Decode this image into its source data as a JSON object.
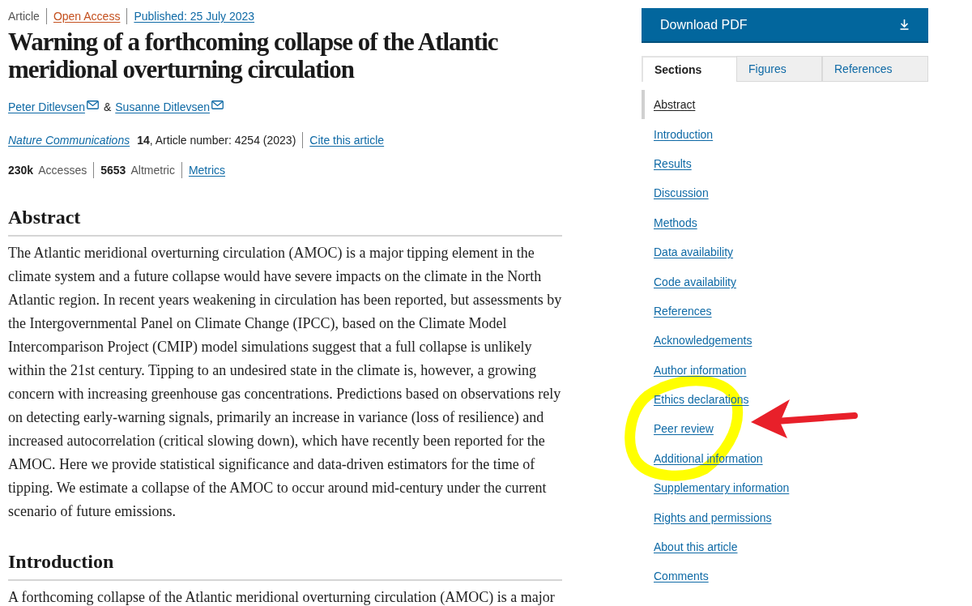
{
  "article_meta": {
    "type": "Article",
    "access": "Open Access",
    "published": "Published: 25 July 2023"
  },
  "title": "Warning of a forthcoming collapse of the Atlantic meridional overturning circulation",
  "authors": [
    {
      "name": "Peter Ditlevsen"
    },
    {
      "name": "Susanne Ditlevsen"
    }
  ],
  "author_separator": "&",
  "citation": {
    "journal": "Nature Communications",
    "details": "**14**, Article number: 4254 (2023)",
    "cite_link": "Cite this article"
  },
  "metrics": [
    {
      "text": "**230k** Accesses"
    },
    {
      "text": "**5653** Altmetric"
    }
  ],
  "metrics_link": "Metrics",
  "sections": [
    {
      "heading": "Abstract",
      "paragraph": "The Atlantic meridional overturning circulation (AMOC) is a major tipping element in the climate system and a future collapse would have severe impacts on the climate in the North Atlantic region. In recent years weakening in circulation has been reported, but assessments by the Intergovernmental Panel on Climate Change (IPCC), based on the Climate Model Intercomparison Project (CMIP) model simulations suggest that a full collapse is unlikely within the 21st century. Tipping to an undesired state in the climate is, however, a growing concern with increasing greenhouse gas concentrations. Predictions based on observations rely on detecting early-warning signals, primarily an increase in variance (loss of resilience) and increased autocorrelation (critical slowing down), which have recently been reported for the AMOC. Here we provide statistical significance and data-driven estimators for the time of tipping. We estimate a collapse of the AMOC to occur around mid-century under the current scenario of future emissions."
    },
    {
      "heading": "Introduction",
      "paragraph": "A forthcoming collapse of the Atlantic meridional overturning circulation (AMOC) is a major"
    }
  ],
  "sidebar": {
    "download_button": "Download PDF",
    "tabs": [
      {
        "label": "Sections",
        "selected": true
      },
      {
        "label": "Figures",
        "selected": false
      },
      {
        "label": "References",
        "selected": false
      }
    ],
    "section_links": [
      {
        "label": "Abstract",
        "selected": true
      },
      {
        "label": "Introduction",
        "selected": false
      },
      {
        "label": "Results",
        "selected": false
      },
      {
        "label": "Discussion",
        "selected": false
      },
      {
        "label": "Methods",
        "selected": false
      },
      {
        "label": "Data availability",
        "selected": false
      },
      {
        "label": "Code availability",
        "selected": false
      },
      {
        "label": "References",
        "selected": false
      },
      {
        "label": "Acknowledgements",
        "selected": false
      },
      {
        "label": "Author information",
        "selected": false
      },
      {
        "label": "Ethics declarations",
        "selected": false
      },
      {
        "label": "Peer review",
        "selected": false
      },
      {
        "label": "Additional information",
        "selected": false
      },
      {
        "label": "Supplementary information",
        "selected": false
      },
      {
        "label": "Rights and permissions",
        "selected": false
      },
      {
        "label": "About this article",
        "selected": false
      },
      {
        "label": "Comments",
        "selected": false
      }
    ]
  }
}
